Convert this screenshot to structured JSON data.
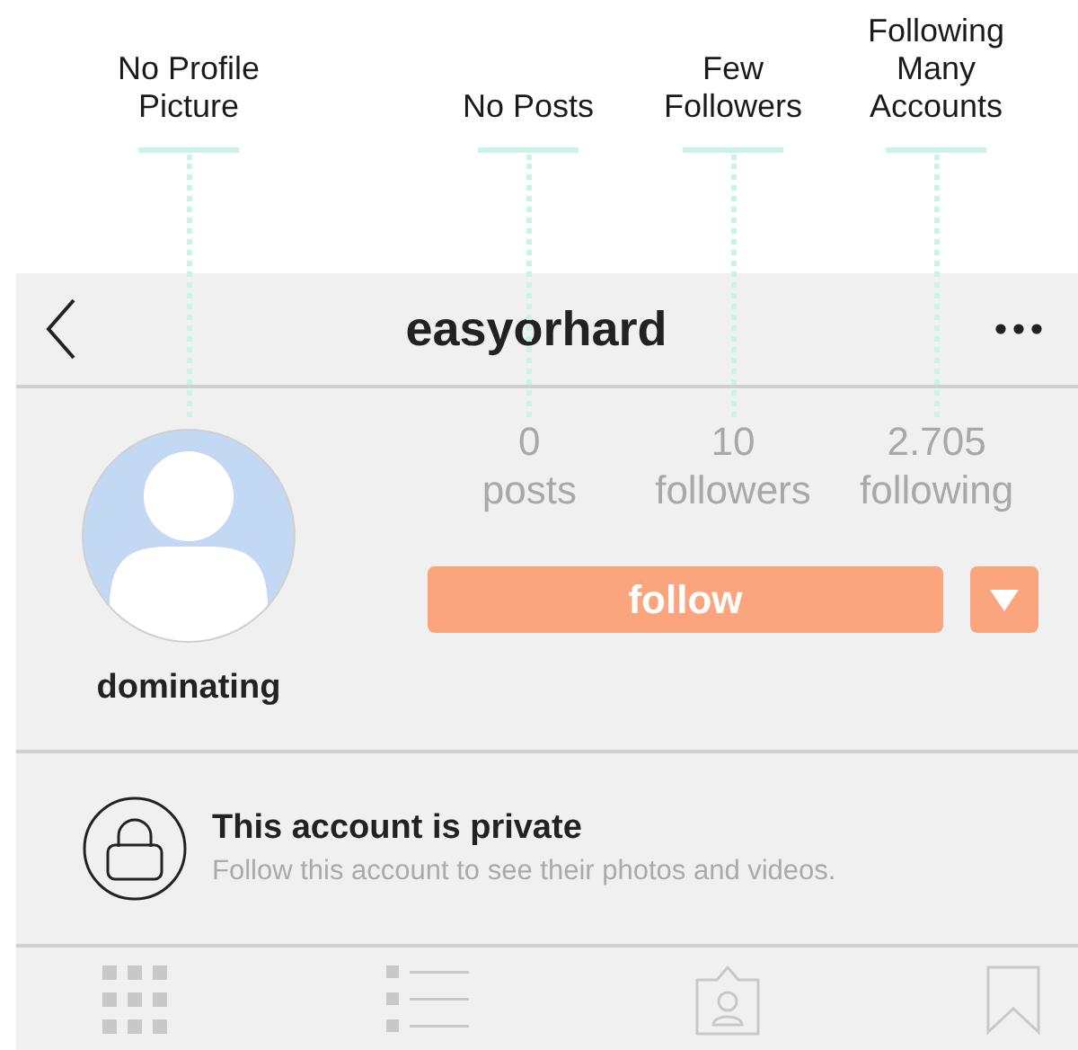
{
  "annotations": [
    {
      "text": "No Profile Picture"
    },
    {
      "text": "No Posts"
    },
    {
      "text": "Few Followers"
    },
    {
      "text": "Following Many Accounts"
    }
  ],
  "header": {
    "title": "easyorhard"
  },
  "profile": {
    "name": "dominating",
    "stats": [
      {
        "value": "0",
        "label": "posts"
      },
      {
        "value": "10",
        "label": "followers"
      },
      {
        "value": "2.705",
        "label": "following"
      }
    ],
    "follow_button": "follow"
  },
  "private_notice": {
    "title": "This account is private",
    "subtitle": "Follow this account to see their photos and videos."
  },
  "tab_bar": [
    {
      "kind": "grid"
    },
    {
      "kind": "list"
    },
    {
      "kind": "tagged"
    },
    {
      "kind": "saved"
    }
  ]
}
